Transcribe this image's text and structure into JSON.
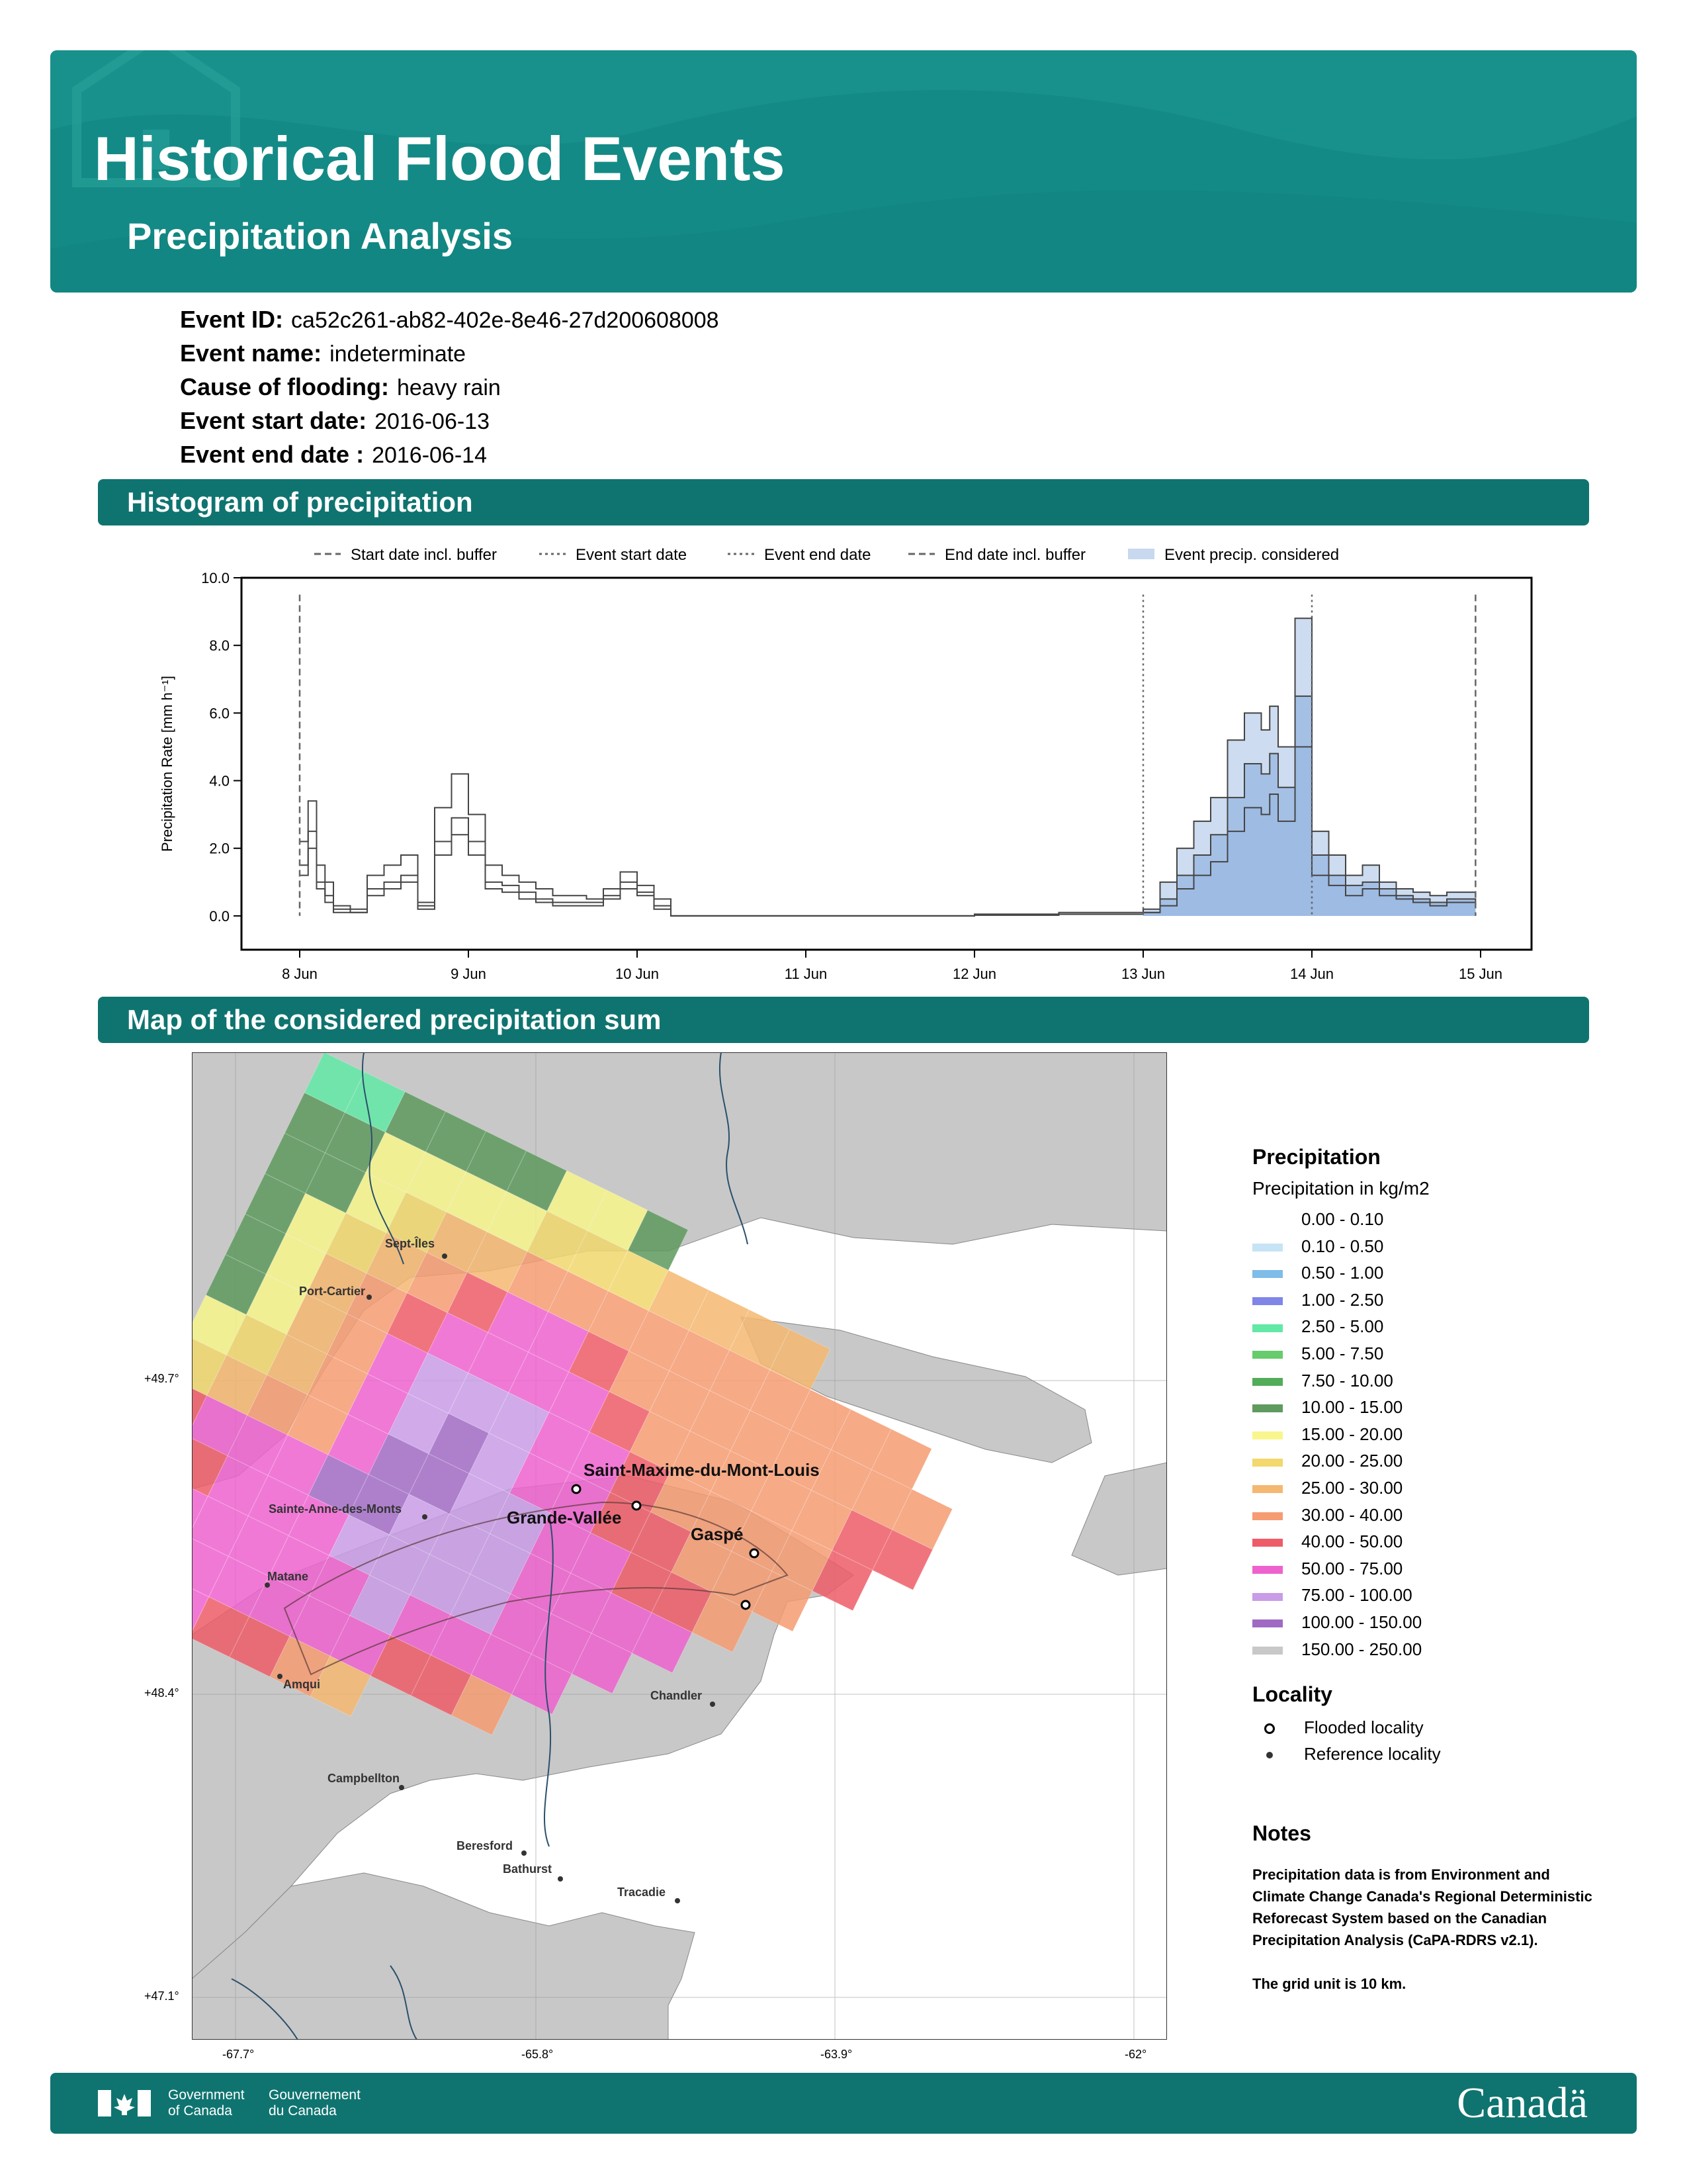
{
  "header": {
    "title": "Historical Flood Events",
    "subtitle": "Precipitation Analysis"
  },
  "event": {
    "id_label": "Event ID:",
    "id_value": "ca52c261-ab82-402e-8e46-27d200608008",
    "name_label": "Event name:",
    "name_value": "indeterminate",
    "cause_label": "Cause of flooding:",
    "cause_value": "heavy rain",
    "start_label": "Event start date:",
    "start_value": "2016-06-13",
    "end_label": "Event end date :",
    "end_value": "2016-06-14"
  },
  "sections": {
    "histogram": "Histogram of precipitation",
    "map": "Map of the considered precipitation sum"
  },
  "chart_data": {
    "type": "area",
    "ylabel": "Precipitation Rate [mm h⁻¹]",
    "ylim": [
      0,
      10
    ],
    "yticks": [
      "0.0",
      "2.0",
      "4.0",
      "6.0",
      "8.0",
      "10.0"
    ],
    "x_ticks": [
      "8 Jun",
      "9 Jun",
      "10 Jun",
      "11 Jun",
      "12 Jun",
      "13 Jun",
      "14 Jun",
      "15 Jun"
    ],
    "legend": [
      "Start date incl. buffer",
      "Event start date",
      "Event end date",
      "End date incl. buffer",
      "Event precip. considered"
    ],
    "legend_position": "top",
    "markers_days": {
      "start_buffer": 0.0,
      "event_start": 5.0,
      "event_end": 6.0,
      "end_buffer": 6.97
    },
    "series": [
      {
        "x": [
          0,
          0.05,
          0.1,
          0.15,
          0.2,
          0.3,
          0.4,
          0.5,
          0.6,
          0.7,
          0.8,
          0.9,
          1.0,
          1.1,
          1.2,
          1.3,
          1.4,
          1.5,
          1.6,
          1.7,
          1.8,
          1.9,
          2.0,
          2.1,
          2.2,
          2.3,
          2.4,
          2.5,
          3,
          4,
          4.5,
          5.0,
          5.1,
          5.2,
          5.3,
          5.4,
          5.5,
          5.6,
          5.7,
          5.75,
          5.8,
          5.9,
          6.0,
          6.1,
          6.2,
          6.3,
          6.4,
          6.5,
          6.6,
          6.7,
          6.8,
          6.97
        ],
        "values": [
          2.2,
          3.4,
          1.5,
          1.0,
          0.3,
          0.2,
          1.2,
          1.5,
          1.8,
          0.4,
          3.2,
          4.2,
          3.0,
          1.5,
          1.2,
          1.0,
          0.8,
          0.6,
          0.6,
          0.5,
          0.8,
          1.3,
          0.9,
          0.5,
          0.0,
          0.0,
          0.0,
          0.0,
          0.0,
          0.05,
          0.1,
          0.2,
          1.0,
          2.0,
          2.8,
          3.5,
          5.2,
          6.0,
          5.5,
          6.2,
          5.0,
          8.8,
          2.5,
          1.8,
          1.2,
          1.5,
          1.0,
          0.8,
          0.7,
          0.6,
          0.7,
          0.6
        ]
      },
      {
        "x": [
          0,
          0.05,
          0.1,
          0.15,
          0.2,
          0.3,
          0.4,
          0.5,
          0.6,
          0.7,
          0.8,
          0.9,
          1.0,
          1.1,
          1.2,
          1.3,
          1.4,
          1.5,
          1.6,
          1.7,
          1.8,
          1.9,
          2.0,
          2.1,
          2.2,
          2.3,
          2.4,
          2.5,
          3,
          4,
          4.5,
          5.0,
          5.1,
          5.2,
          5.3,
          5.4,
          5.5,
          5.6,
          5.7,
          5.75,
          5.8,
          5.9,
          6.0,
          6.1,
          6.2,
          6.3,
          6.4,
          6.5,
          6.6,
          6.7,
          6.8,
          6.97
        ],
        "values": [
          1.5,
          2.5,
          1.0,
          0.6,
          0.2,
          0.1,
          0.8,
          1.0,
          1.2,
          0.3,
          2.2,
          2.9,
          2.2,
          1.0,
          0.9,
          0.7,
          0.5,
          0.4,
          0.4,
          0.4,
          0.6,
          1.0,
          0.7,
          0.3,
          0.0,
          0.0,
          0.0,
          0.0,
          0.0,
          0.05,
          0.05,
          0.1,
          0.5,
          1.2,
          1.8,
          2.4,
          3.5,
          4.5,
          4.2,
          4.8,
          3.8,
          6.5,
          1.8,
          1.2,
          0.9,
          1.0,
          0.8,
          0.6,
          0.5,
          0.4,
          0.5,
          0.4
        ]
      },
      {
        "x": [
          0,
          0.05,
          0.1,
          0.15,
          0.2,
          0.3,
          0.4,
          0.5,
          0.6,
          0.7,
          0.8,
          0.9,
          1.0,
          1.1,
          1.2,
          1.3,
          1.4,
          1.5,
          1.6,
          1.7,
          1.8,
          1.9,
          2.0,
          2.1,
          2.2,
          2.3,
          2.4,
          2.5,
          3,
          4,
          4.5,
          5.0,
          5.1,
          5.2,
          5.3,
          5.4,
          5.5,
          5.6,
          5.7,
          5.75,
          5.8,
          5.9,
          6.0,
          6.1,
          6.2,
          6.3,
          6.4,
          6.5,
          6.6,
          6.7,
          6.8,
          6.97
        ],
        "values": [
          1.2,
          2.0,
          0.8,
          0.4,
          0.1,
          0.1,
          0.6,
          0.8,
          1.0,
          0.2,
          1.8,
          2.4,
          1.8,
          0.8,
          0.7,
          0.5,
          0.4,
          0.3,
          0.3,
          0.3,
          0.5,
          0.8,
          0.6,
          0.2,
          0.0,
          0.0,
          0.0,
          0.0,
          0.0,
          0.02,
          0.05,
          0.1,
          0.3,
          0.8,
          1.2,
          1.6,
          2.5,
          3.2,
          3.0,
          3.6,
          2.8,
          5.0,
          1.2,
          0.9,
          0.6,
          0.8,
          0.6,
          0.5,
          0.4,
          0.3,
          0.4,
          0.3
        ]
      }
    ]
  },
  "map": {
    "lat_labels": [
      "+49.7°",
      "+48.4°",
      "+47.1°"
    ],
    "lon_labels": [
      "-67.7°",
      "-65.8°",
      "-63.9°",
      "-62°"
    ],
    "flooded_localities": [
      "Saint-Maxime-du-Mont-Louis",
      "Grande-Vallée",
      "Gaspé"
    ],
    "reference_localities": [
      "Sept-Îles",
      "Port-Cartier",
      "Sainte-Anne-des-Monts",
      "Matane",
      "Amqui",
      "Chandler",
      "Campbellton",
      "Beresford",
      "Bathurst",
      "Tracadie"
    ],
    "grid_values_kgm2": [
      [
        3.0,
        3.0,
        12,
        12,
        12,
        12,
        18,
        18,
        12
      ],
      [
        12,
        12,
        18,
        18,
        18,
        18,
        22,
        22,
        22,
        27,
        27,
        27,
        27
      ],
      [
        12,
        12,
        18,
        22,
        27,
        27,
        35,
        35,
        35,
        35,
        35,
        35,
        35,
        35,
        35,
        35
      ],
      [
        12,
        18,
        22,
        27,
        35,
        45,
        60,
        60,
        45,
        35,
        35,
        35,
        35,
        35,
        35,
        35,
        35
      ],
      [
        12,
        18,
        27,
        35,
        45,
        60,
        60,
        60,
        60,
        45,
        35,
        35,
        35,
        35,
        35,
        45,
        45
      ],
      [
        12,
        18,
        27,
        35,
        60,
        85,
        85,
        85,
        60,
        60,
        45,
        35,
        35,
        35,
        35,
        45
      ],
      [
        18,
        22,
        27,
        35,
        60,
        85,
        120,
        85,
        60,
        60,
        45,
        45,
        35,
        35,
        35
      ],
      [
        22,
        27,
        35,
        35,
        60,
        120,
        120,
        85,
        85,
        60,
        60,
        45,
        45,
        35
      ],
      [
        45,
        60,
        60,
        60,
        120,
        120,
        85,
        85,
        85,
        60,
        60,
        60,
        60
      ],
      [
        45,
        45,
        60,
        60,
        60,
        85,
        85,
        85,
        85,
        60,
        60,
        60
      ],
      [
        45,
        60,
        60,
        60,
        60,
        60,
        85,
        60,
        60,
        60,
        60
      ],
      [
        45,
        60,
        60,
        60,
        60,
        60,
        60,
        45,
        45,
        35
      ],
      [
        35,
        60,
        60,
        45,
        45,
        35,
        27
      ]
    ]
  },
  "legend": {
    "precip_title": "Precipitation",
    "precip_sub": "Precipitation in kg/m2",
    "precip_items": [
      {
        "label": "0.00 - 0.10",
        "color": "#ffffff"
      },
      {
        "label": "0.10 - 0.50",
        "color": "#c6e4f5"
      },
      {
        "label": "0.50 - 1.00",
        "color": "#7fbce8"
      },
      {
        "label": "1.00 - 2.50",
        "color": "#8085e8"
      },
      {
        "label": "2.50 - 5.00",
        "color": "#62e9a6"
      },
      {
        "label": "5.00 - 7.50",
        "color": "#67cc6b"
      },
      {
        "label": "7.50 - 10.00",
        "color": "#52ac5a"
      },
      {
        "label": "10.00 - 15.00",
        "color": "#5f9a5f"
      },
      {
        "label": "15.00 - 20.00",
        "color": "#f8f68c"
      },
      {
        "label": "20.00 - 25.00",
        "color": "#f2d86d"
      },
      {
        "label": "25.00 - 30.00",
        "color": "#f5b870"
      },
      {
        "label": "30.00 - 40.00",
        "color": "#f59c72"
      },
      {
        "label": "40.00 - 50.00",
        "color": "#ee5c68"
      },
      {
        "label": "50.00 - 75.00",
        "color": "#ee62cf"
      },
      {
        "label": "75.00 - 100.00",
        "color": "#c89ce6"
      },
      {
        "label": "100.00 - 150.00",
        "color": "#a06ac4"
      },
      {
        "label": "150.00 - 250.00",
        "color": "#c8c8c8"
      }
    ],
    "locality_title": "Locality",
    "flooded_label": "Flooded locality",
    "reference_label": "Reference locality",
    "notes_title": "Notes",
    "notes_text": "Precipitation data is from Environment and Climate Change Canada's Regional Deterministic Reforecast System based on the Canadian Precipitation Analysis (CaPA-RDRS v2.1).",
    "notes_grid": "The grid unit is 10 km."
  },
  "footer": {
    "gov_en": "Government\nof Canada",
    "gov_fr": "Gouvernement\ndu Canada",
    "wordmark": "Canadä"
  },
  "colors": {
    "brand_teal": "#148a86",
    "bar_teal": "#0f7470",
    "event_fill": "#9bb9e2"
  }
}
